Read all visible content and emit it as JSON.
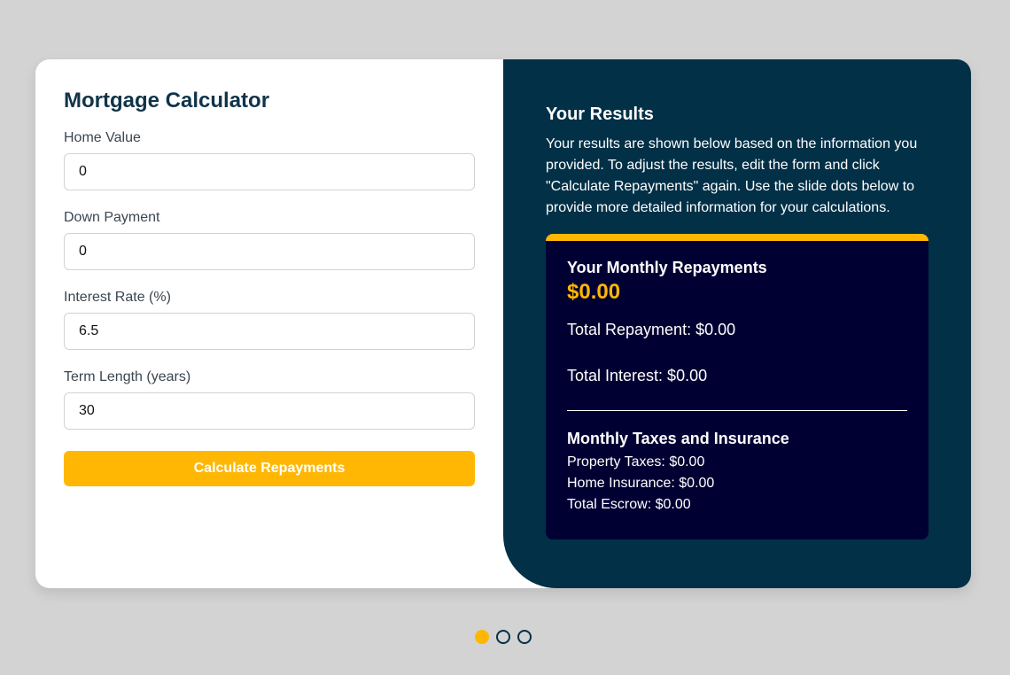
{
  "form": {
    "title": "Mortgage Calculator",
    "fields": [
      {
        "label": "Home Value",
        "value": "0"
      },
      {
        "label": "Down Payment",
        "value": "0"
      },
      {
        "label": "Interest Rate (%)",
        "value": "6.5"
      },
      {
        "label": "Term Length (years)",
        "value": "30"
      }
    ],
    "button_label": "Calculate Repayments"
  },
  "results": {
    "title": "Your Results",
    "description": "Your results are shown below based on the information you provided. To adjust the results, edit the form and click \"Calculate Repayments\" again. Use the slide dots below to provide more detailed information for your calculations.",
    "monthly_label": "Your Monthly Repayments",
    "monthly_value": "$0.00",
    "total_repayment": "Total Repayment: $0.00",
    "total_interest": "Total Interest: $0.00",
    "taxes_title": "Monthly Taxes and Insurance",
    "property_taxes": "Property Taxes: $0.00",
    "home_insurance": "Home Insurance: $0.00",
    "total_escrow": "Total Escrow: $0.00"
  },
  "slides": {
    "count": 3,
    "active_index": 0
  },
  "colors": {
    "background": "#d3d3d3",
    "panel_dark": "#023047",
    "box_dark": "#000033",
    "accent": "#ffb703",
    "title_text": "#10344a"
  }
}
